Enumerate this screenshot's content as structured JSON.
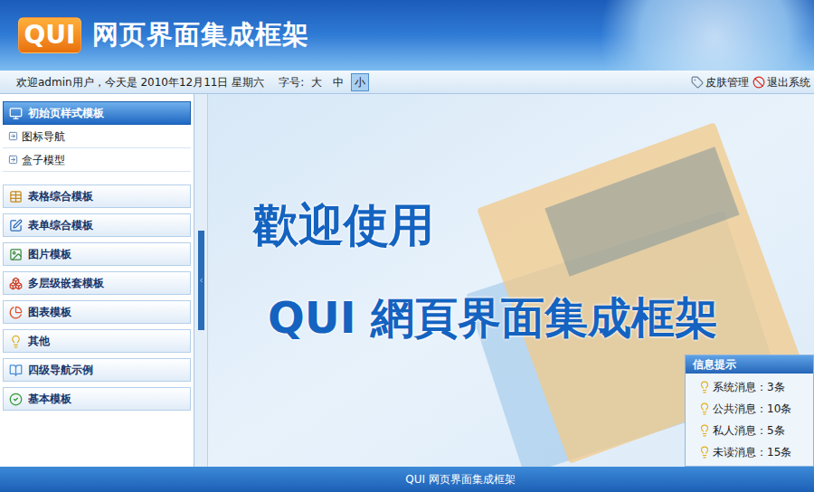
{
  "header": {
    "logo": "QUI",
    "title": "网页界面集成框架"
  },
  "topbar": {
    "welcome": "欢迎admin用户，今天是 2010年12月11日 星期六",
    "font_size_label": "字号:",
    "font_sizes": [
      {
        "label": "大",
        "selected": false
      },
      {
        "label": "中",
        "selected": false
      },
      {
        "label": "小",
        "selected": true
      }
    ],
    "links": [
      "皮肤管理",
      "退出系统"
    ]
  },
  "sidebar": {
    "groups": [
      {
        "label": "初始页样式模板",
        "expanded": true,
        "selected": true,
        "items": [
          "图标导航",
          "盒子模型"
        ]
      },
      {
        "label": "表格综合模板",
        "expanded": false,
        "selected": false,
        "items": []
      },
      {
        "label": "表单综合模板",
        "expanded": false,
        "selected": false,
        "items": []
      },
      {
        "label": "图片模板",
        "expanded": false,
        "selected": false,
        "items": []
      },
      {
        "label": "多层级嵌套模板",
        "expanded": false,
        "selected": false,
        "items": []
      },
      {
        "label": "图表模板",
        "expanded": false,
        "selected": false,
        "items": []
      },
      {
        "label": "其他",
        "expanded": false,
        "selected": false,
        "items": []
      },
      {
        "label": "四级导航示例",
        "expanded": false,
        "selected": false,
        "items": []
      },
      {
        "label": "基本模板",
        "expanded": false,
        "selected": false,
        "items": []
      }
    ]
  },
  "welcome": {
    "line1": "歡迎使用",
    "line2": "QUI 網頁界面集成框架"
  },
  "info_panel": {
    "title": "信息提示",
    "items": [
      "系统消息：3条",
      "公共消息：10条",
      "私人消息：5条",
      "未读消息：15条"
    ]
  },
  "footer": "QUI 网页界面集成框架"
}
